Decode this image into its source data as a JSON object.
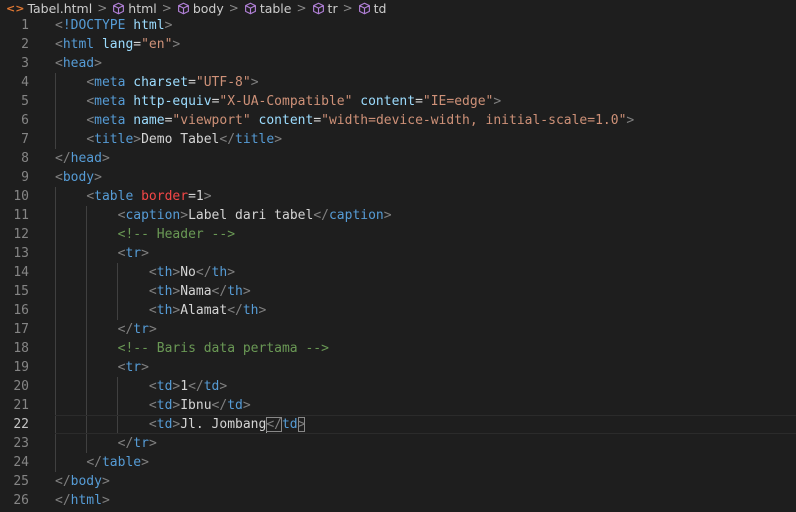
{
  "breadcrumb": {
    "file_icon": "<>",
    "file": "Tabel.html",
    "items": [
      "html",
      "body",
      "table",
      "tr",
      "td"
    ],
    "separator": ">"
  },
  "colors": {
    "background": "#1e1e1e",
    "tag": "#569cd6",
    "attribute": "#9cdcfe",
    "string": "#ce9178",
    "comment": "#6a9955",
    "text": "#d4d4d4"
  },
  "cursor": {
    "line": 22
  },
  "lines": [
    {
      "n": "1",
      "tokens": [
        [
          "punct",
          "<"
        ],
        [
          "tag",
          "!DOCTYPE"
        ],
        [
          "text",
          " "
        ],
        [
          "attr",
          "html"
        ],
        [
          "punct",
          ">"
        ]
      ]
    },
    {
      "n": "2",
      "tokens": [
        [
          "punct",
          "<"
        ],
        [
          "tag",
          "html"
        ],
        [
          "text",
          " "
        ],
        [
          "attr",
          "lang"
        ],
        [
          "eq",
          "="
        ],
        [
          "str",
          "\"en\""
        ],
        [
          "punct",
          ">"
        ]
      ]
    },
    {
      "n": "3",
      "tokens": [
        [
          "punct",
          "<"
        ],
        [
          "tag",
          "head"
        ],
        [
          "punct",
          ">"
        ]
      ]
    },
    {
      "n": "4",
      "tokens": [
        [
          "text",
          "    "
        ],
        [
          "punct",
          "<"
        ],
        [
          "tag",
          "meta"
        ],
        [
          "text",
          " "
        ],
        [
          "attr",
          "charset"
        ],
        [
          "eq",
          "="
        ],
        [
          "str",
          "\"UTF-8\""
        ],
        [
          "punct",
          ">"
        ]
      ]
    },
    {
      "n": "5",
      "tokens": [
        [
          "text",
          "    "
        ],
        [
          "punct",
          "<"
        ],
        [
          "tag",
          "meta"
        ],
        [
          "text",
          " "
        ],
        [
          "attr",
          "http-equiv"
        ],
        [
          "eq",
          "="
        ],
        [
          "str",
          "\"X-UA-Compatible\""
        ],
        [
          "text",
          " "
        ],
        [
          "attr",
          "content"
        ],
        [
          "eq",
          "="
        ],
        [
          "str",
          "\"IE=edge\""
        ],
        [
          "punct",
          ">"
        ]
      ]
    },
    {
      "n": "6",
      "tokens": [
        [
          "text",
          "    "
        ],
        [
          "punct",
          "<"
        ],
        [
          "tag",
          "meta"
        ],
        [
          "text",
          " "
        ],
        [
          "attr",
          "name"
        ],
        [
          "eq",
          "="
        ],
        [
          "str",
          "\"viewport\""
        ],
        [
          "text",
          " "
        ],
        [
          "attr",
          "content"
        ],
        [
          "eq",
          "="
        ],
        [
          "str",
          "\"width=device-width, initial-scale=1.0\""
        ],
        [
          "punct",
          ">"
        ]
      ]
    },
    {
      "n": "7",
      "tokens": [
        [
          "text",
          "    "
        ],
        [
          "punct",
          "<"
        ],
        [
          "tag",
          "title"
        ],
        [
          "punct",
          ">"
        ],
        [
          "text",
          "Demo Tabel"
        ],
        [
          "punct",
          "</"
        ],
        [
          "tag",
          "title"
        ],
        [
          "punct",
          ">"
        ]
      ]
    },
    {
      "n": "8",
      "tokens": [
        [
          "punct",
          "</"
        ],
        [
          "tag",
          "head"
        ],
        [
          "punct",
          ">"
        ]
      ]
    },
    {
      "n": "9",
      "tokens": [
        [
          "punct",
          "<"
        ],
        [
          "tag",
          "body"
        ],
        [
          "punct",
          ">"
        ]
      ]
    },
    {
      "n": "10",
      "tokens": [
        [
          "text",
          "    "
        ],
        [
          "punct",
          "<"
        ],
        [
          "tag",
          "table"
        ],
        [
          "text",
          " "
        ],
        [
          "attrred",
          "border"
        ],
        [
          "eq",
          "="
        ],
        [
          "text",
          "1"
        ],
        [
          "punct",
          ">"
        ]
      ]
    },
    {
      "n": "11",
      "tokens": [
        [
          "text",
          "        "
        ],
        [
          "punct",
          "<"
        ],
        [
          "tag",
          "caption"
        ],
        [
          "punct",
          ">"
        ],
        [
          "text",
          "Label dari tabel"
        ],
        [
          "punct",
          "</"
        ],
        [
          "tag",
          "caption"
        ],
        [
          "punct",
          ">"
        ]
      ]
    },
    {
      "n": "12",
      "tokens": [
        [
          "text",
          "        "
        ],
        [
          "comment",
          "<!-- Header -->"
        ]
      ]
    },
    {
      "n": "13",
      "tokens": [
        [
          "text",
          "        "
        ],
        [
          "punct",
          "<"
        ],
        [
          "tag",
          "tr"
        ],
        [
          "punct",
          ">"
        ]
      ]
    },
    {
      "n": "14",
      "tokens": [
        [
          "text",
          "            "
        ],
        [
          "punct",
          "<"
        ],
        [
          "tag",
          "th"
        ],
        [
          "punct",
          ">"
        ],
        [
          "text",
          "No"
        ],
        [
          "punct",
          "</"
        ],
        [
          "tag",
          "th"
        ],
        [
          "punct",
          ">"
        ]
      ]
    },
    {
      "n": "15",
      "tokens": [
        [
          "text",
          "            "
        ],
        [
          "punct",
          "<"
        ],
        [
          "tag",
          "th"
        ],
        [
          "punct",
          ">"
        ],
        [
          "text",
          "Nama"
        ],
        [
          "punct",
          "</"
        ],
        [
          "tag",
          "th"
        ],
        [
          "punct",
          ">"
        ]
      ]
    },
    {
      "n": "16",
      "tokens": [
        [
          "text",
          "            "
        ],
        [
          "punct",
          "<"
        ],
        [
          "tag",
          "th"
        ],
        [
          "punct",
          ">"
        ],
        [
          "text",
          "Alamat"
        ],
        [
          "punct",
          "</"
        ],
        [
          "tag",
          "th"
        ],
        [
          "punct",
          ">"
        ]
      ]
    },
    {
      "n": "17",
      "tokens": [
        [
          "text",
          "        "
        ],
        [
          "punct",
          "</"
        ],
        [
          "tag",
          "tr"
        ],
        [
          "punct",
          ">"
        ]
      ]
    },
    {
      "n": "18",
      "tokens": [
        [
          "text",
          "        "
        ],
        [
          "comment",
          "<!-- Baris data pertama -->"
        ]
      ]
    },
    {
      "n": "19",
      "tokens": [
        [
          "text",
          "        "
        ],
        [
          "punct",
          "<"
        ],
        [
          "tag",
          "tr"
        ],
        [
          "punct",
          ">"
        ]
      ]
    },
    {
      "n": "20",
      "tokens": [
        [
          "text",
          "            "
        ],
        [
          "punct",
          "<"
        ],
        [
          "tag",
          "td"
        ],
        [
          "punct",
          ">"
        ],
        [
          "text",
          "1"
        ],
        [
          "punct",
          "</"
        ],
        [
          "tag",
          "td"
        ],
        [
          "punct",
          ">"
        ]
      ]
    },
    {
      "n": "21",
      "tokens": [
        [
          "text",
          "            "
        ],
        [
          "punct",
          "<"
        ],
        [
          "tag",
          "td"
        ],
        [
          "punct",
          ">"
        ],
        [
          "text",
          "Ibnu"
        ],
        [
          "punct",
          "</"
        ],
        [
          "tag",
          "td"
        ],
        [
          "punct",
          ">"
        ]
      ]
    },
    {
      "n": "22",
      "tokens": [
        [
          "text",
          "            "
        ],
        [
          "punct",
          "<"
        ],
        [
          "tag",
          "td"
        ],
        [
          "punct",
          ">"
        ],
        [
          "text",
          "Jl. Jombang"
        ],
        [
          "punct",
          "</"
        ],
        [
          "tag",
          "td"
        ],
        [
          "punct",
          ">"
        ]
      ]
    },
    {
      "n": "23",
      "tokens": [
        [
          "text",
          "        "
        ],
        [
          "punct",
          "</"
        ],
        [
          "tag",
          "tr"
        ],
        [
          "punct",
          ">"
        ]
      ]
    },
    {
      "n": "24",
      "tokens": [
        [
          "text",
          "    "
        ],
        [
          "punct",
          "</"
        ],
        [
          "tag",
          "table"
        ],
        [
          "punct",
          ">"
        ]
      ]
    },
    {
      "n": "25",
      "tokens": [
        [
          "punct",
          "</"
        ],
        [
          "tag",
          "body"
        ],
        [
          "punct",
          ">"
        ]
      ]
    },
    {
      "n": "26",
      "tokens": [
        [
          "punct",
          "</"
        ],
        [
          "tag",
          "html"
        ],
        [
          "punct",
          ">"
        ]
      ]
    }
  ]
}
